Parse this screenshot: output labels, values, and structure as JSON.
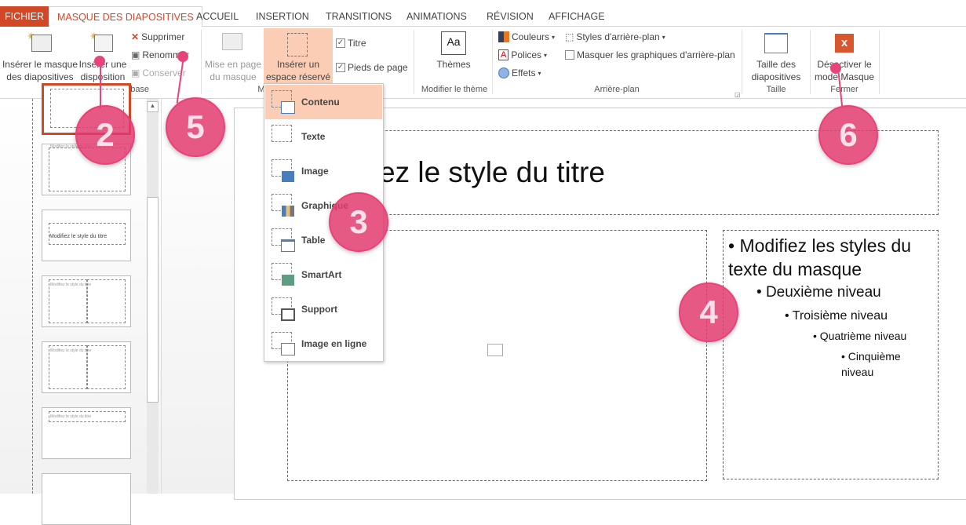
{
  "tabs": [
    {
      "label": "FICHIER"
    },
    {
      "label": "MASQUE DES DIAPOSITIVES"
    },
    {
      "label": "ACCUEIL"
    },
    {
      "label": "INSERTION"
    },
    {
      "label": "TRANSITIONS"
    },
    {
      "label": "ANIMATIONS"
    },
    {
      "label": "RÉVISION"
    },
    {
      "label": "AFFICHAGE"
    }
  ],
  "ribbon": {
    "insert_master": "Insérer le masque des diapositives",
    "insert_layout": "Insérer une disposition",
    "delete": "Supprimer",
    "rename": "Renommer",
    "preserve": "Conserver",
    "group_edit_master": "Modifier la forme de base",
    "master_layout": "Mise en page du masque",
    "insert_placeholder": "Insérer un espace réservé",
    "title_check": "Titre",
    "footers_check": "Pieds de page",
    "title_checked": true,
    "footers_checked": true,
    "group_master_layout": "M",
    "themes": "Thèmes",
    "group_edit_theme": "Modifier le thème",
    "colors": "Couleurs",
    "fonts": "Polices",
    "effects": "Effets",
    "bg_styles": "Styles d'arrière-plan",
    "hide_bg": "Masquer les graphiques d'arrière-plan",
    "hide_bg_checked": false,
    "group_background": "Arrière-plan",
    "slide_size": "Taille des diapositives",
    "group_size": "Taille",
    "close_master": "Désactiver le mode Masque",
    "group_close": "Fermer",
    "accent": "#d24726"
  },
  "thumbnails": {
    "title_text": "Modifiez le style du titre"
  },
  "menu": {
    "items": [
      {
        "label": "Contenu",
        "icon": "content-icon"
      },
      {
        "label": "Texte",
        "icon": "text-icon"
      },
      {
        "label": "Image",
        "icon": "picture-icon"
      },
      {
        "label": "Graphique",
        "icon": "chart-icon"
      },
      {
        "label": "Table",
        "icon": "table-icon"
      },
      {
        "label": "SmartArt",
        "icon": "smartart-icon"
      },
      {
        "label": "Support",
        "icon": "media-icon"
      },
      {
        "label": "Image en ligne",
        "icon": "online-picture-icon"
      }
    ]
  },
  "slide": {
    "title": "ez le style du titre",
    "levels": [
      "Modifiez les styles du texte du masque",
      "Deuxième niveau",
      "Troisième niveau",
      "Quatrième niveau",
      "Cinquième niveau"
    ]
  },
  "callouts": [
    "2",
    "5",
    "3",
    "4",
    "6"
  ]
}
